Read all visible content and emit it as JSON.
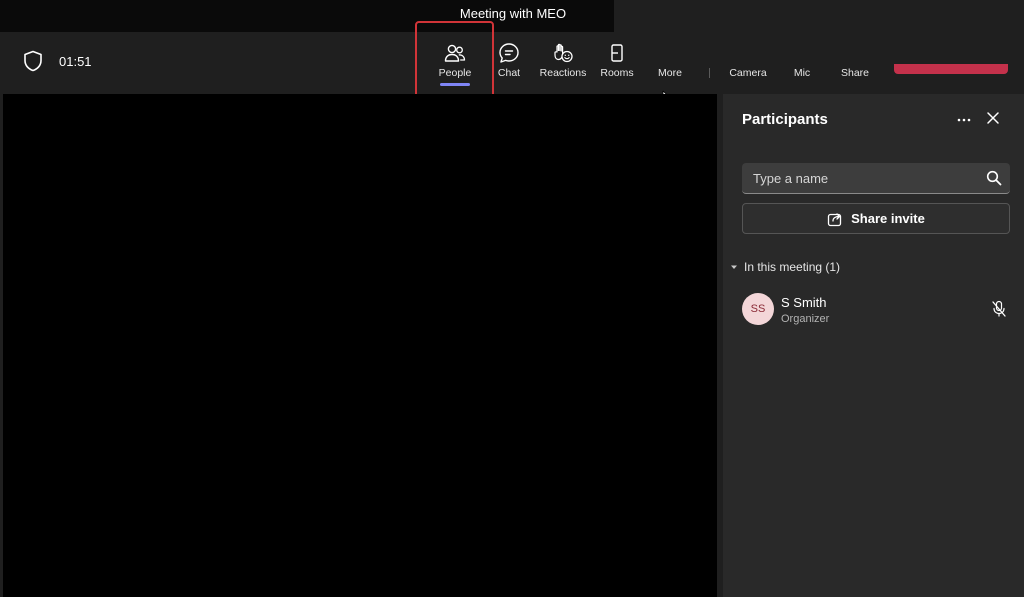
{
  "meeting": {
    "title": "Meeting with MEO",
    "timer": "01:51"
  },
  "toolbar": {
    "people_label": "People",
    "chat_label": "Chat",
    "reactions_label": "Reactions",
    "rooms_label": "Rooms",
    "more_label": "More",
    "camera_label": "Camera",
    "mic_label": "Mic",
    "share_label": "Share",
    "active_tab": "People",
    "accent_color": "#7f85f5",
    "leave_color": "#c4314b"
  },
  "panel": {
    "title": "Participants",
    "search_placeholder": "Type a name",
    "share_invite_label": "Share invite",
    "section_label": "In this meeting (1)",
    "participants": [
      {
        "initials": "SS",
        "name": "S Smith",
        "role": "Organizer",
        "muted": true
      }
    ]
  },
  "icons": {
    "shield": "shield-icon",
    "people": "people-icon",
    "chat": "chat-icon",
    "reactions": "raise-hand-icon",
    "rooms": "rooms-icon",
    "more": "more-icon",
    "search": "search-icon",
    "share": "share-icon",
    "close": "close-icon",
    "mic_off": "mic-off-icon"
  }
}
